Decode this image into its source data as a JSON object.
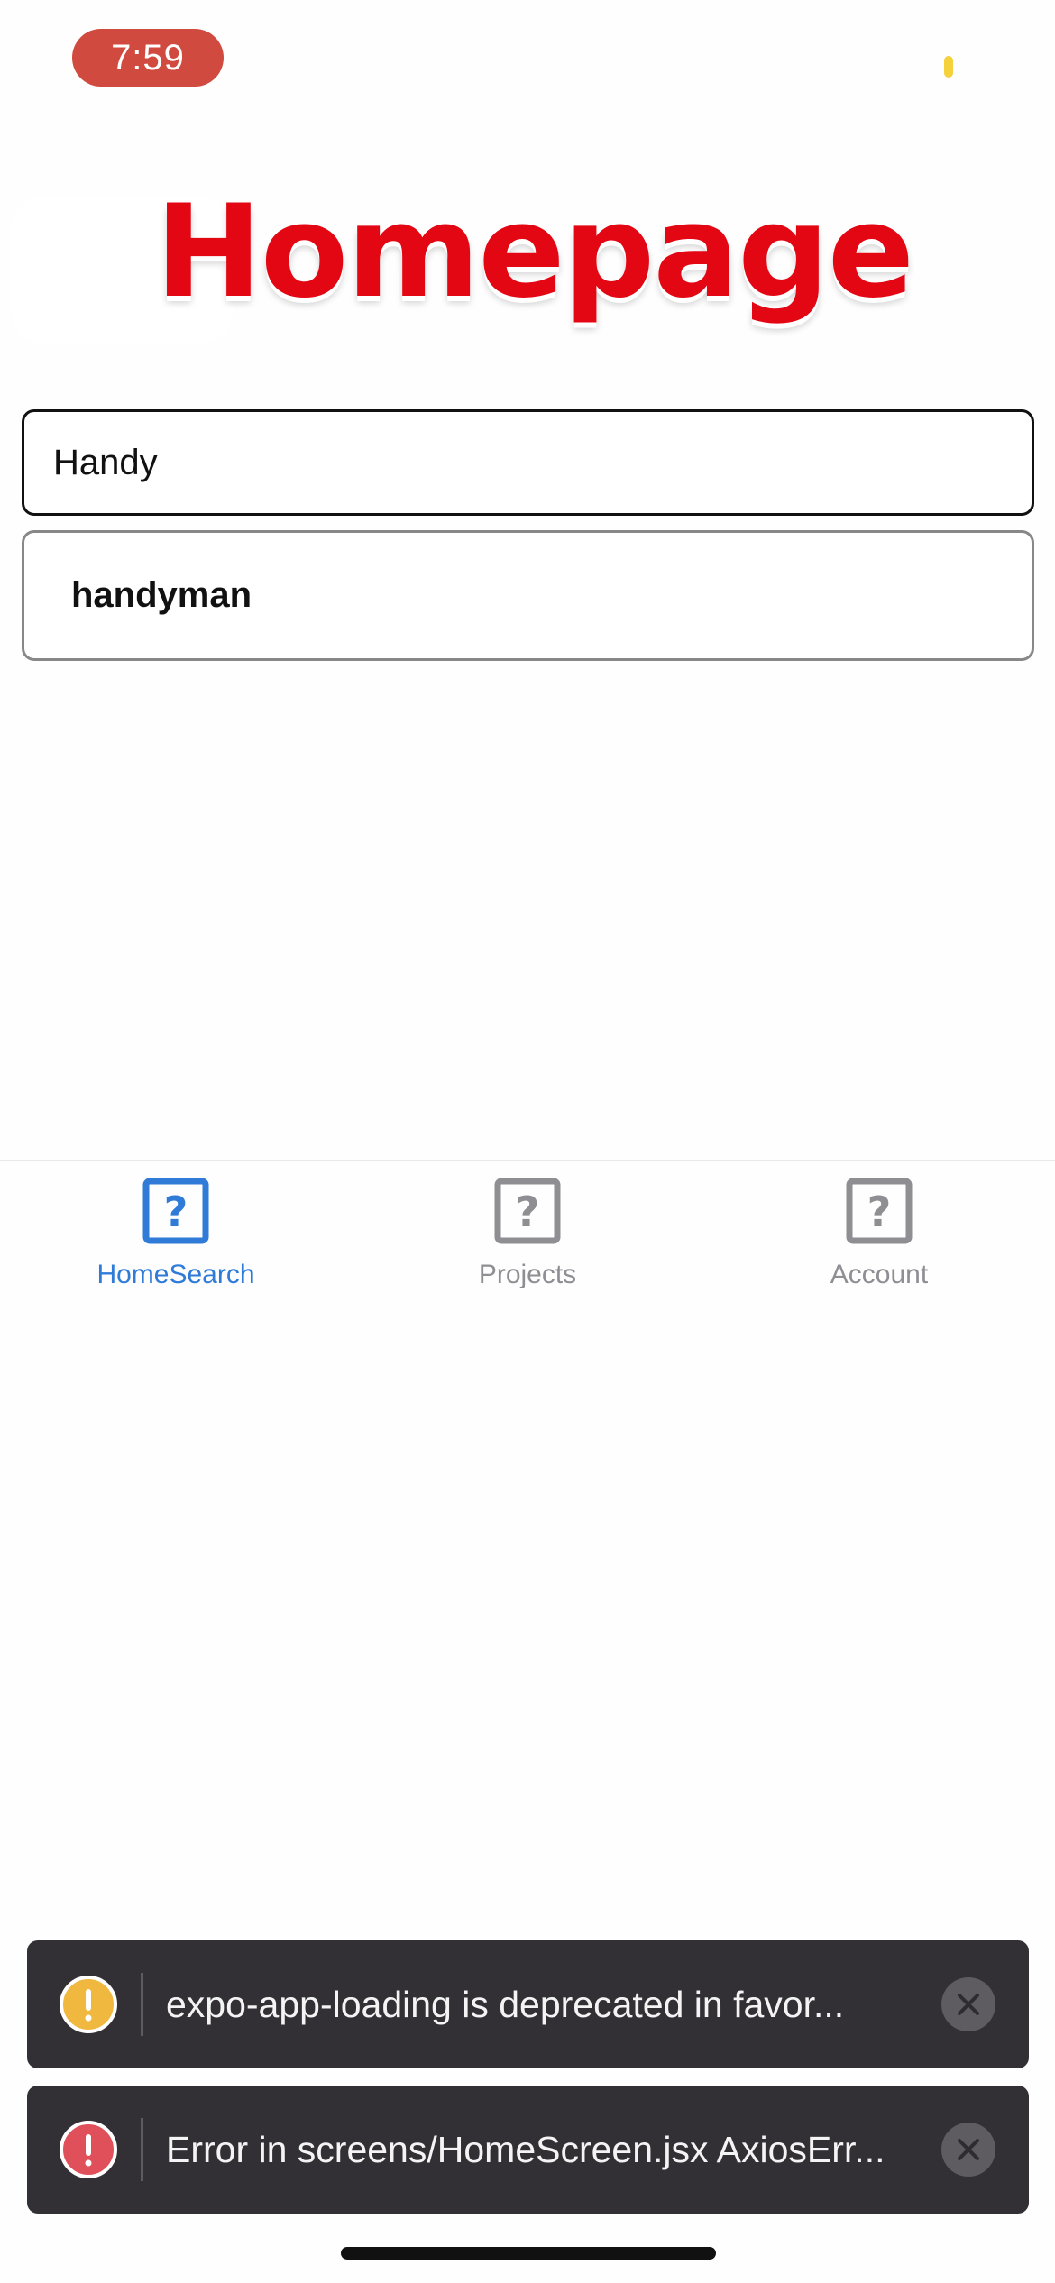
{
  "status_bar": {
    "time": "7:59"
  },
  "header": {
    "title": "Homepage"
  },
  "search": {
    "value": "Handy"
  },
  "suggestions": [
    {
      "label": "handyman"
    }
  ],
  "tabs": [
    {
      "label": "HomeSearch",
      "icon": "question-box-icon",
      "active": true
    },
    {
      "label": "Projects",
      "icon": "question-box-icon",
      "active": false
    },
    {
      "label": "Account",
      "icon": "question-box-icon",
      "active": false
    }
  ],
  "toasts": [
    {
      "type": "warning",
      "message": "expo-app-loading is deprecated in favor..."
    },
    {
      "type": "error",
      "message": "Error in screens/HomeScreen.jsx AxiosErr..."
    }
  ],
  "colors": {
    "title": "#e30613",
    "tab_active": "#2f7bd7",
    "tab_inactive": "#8e8e93",
    "warning": "#f0b83f",
    "error": "#e0505a",
    "toast_bg": "#323035"
  }
}
